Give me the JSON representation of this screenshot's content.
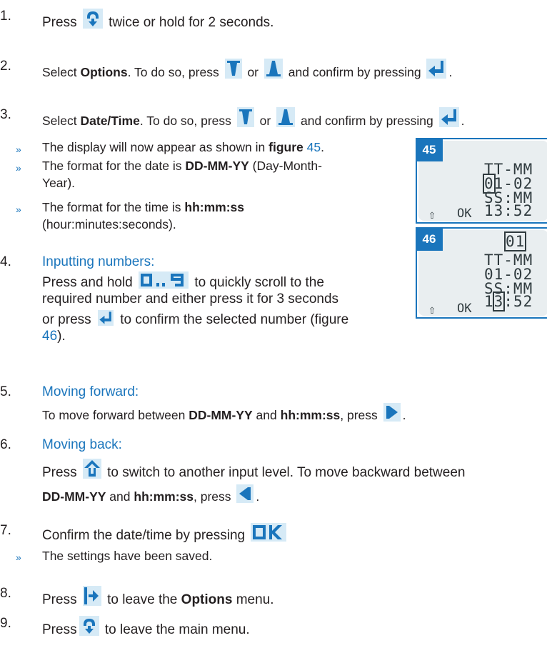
{
  "steps": {
    "s1": {
      "num": "1.",
      "a": "Press",
      "b": "twice or hold for 2 seconds."
    },
    "s2": {
      "num": "2.",
      "a": "Select ",
      "b": "Options",
      "c": ". To do so, press",
      "d": "or",
      "e": "and confirm by pressing",
      "f": "."
    },
    "s3": {
      "num": "3.",
      "a": "Select ",
      "b": "Date/Time",
      "c": ". To do so, press",
      "d": "or",
      "e": "and confirm by pressing",
      "f": "."
    },
    "b1": {
      "a": "The display will now appear as shown in ",
      "b": "figure",
      "c": " 45",
      "d": "."
    },
    "b2": {
      "a": "The format for the date is ",
      "b": "DD-MM-YY",
      "c": " (Day-Month-",
      "d": "Year)."
    },
    "b3": {
      "a": "The format for the time is ",
      "b": "hh:mm:ss",
      "c": "(hour:minutes:seconds)."
    },
    "s4": {
      "num": "4.",
      "title": "Inputting numbers:",
      "a": "Press and hold",
      "b": "to quickly scroll to the",
      "c": "required number and either press it for 3 seconds",
      "d": "or press",
      "e": "to confirm the selected number (figure",
      "f": "46",
      "g": ")."
    },
    "s5": {
      "num": "5.",
      "title": "Moving forward:",
      "a": "To move forward between ",
      "b": "DD-MM-YY",
      "c": " and ",
      "d": "hh:mm:ss",
      "e": ", press",
      "f": "."
    },
    "s6": {
      "num": "6.",
      "title": "Moving back:",
      "a": "Press",
      "b": "to switch to another input level. To move backward between",
      "c": "DD-MM-YY",
      "d": " and ",
      "e": "hh:mm:ss",
      "f": ", press",
      "g": "."
    },
    "s7": {
      "num": "7.",
      "a": "Confirm the date/time by pressing"
    },
    "b4": {
      "a": "The settings have been saved."
    },
    "s8": {
      "num": "8.",
      "a": "Press",
      "b": "to leave the ",
      "c": "Options",
      "d": " menu."
    },
    "s9": {
      "num": "9.",
      "a": "Press",
      "b": "to leave the main menu."
    },
    "bullet_glyph": "»",
    "figures": {
      "f45": {
        "label": "45",
        "l1": "TT-MM",
        "l2": "01-02",
        "l3": "SS:MM",
        "l4": "13:52",
        "up": "⇧",
        "ok": "OK"
      },
      "f46": {
        "label": "46",
        "top": "01",
        "l1": "TT-MM",
        "l2": "01-02",
        "l3": "SS:MM",
        "l4": "13:52",
        "up": "⇧",
        "ok": "OK"
      }
    },
    "colors": {
      "accent": "#1a75bc",
      "text": "#231f20",
      "lcd_bg": "#e9eef0"
    }
  }
}
